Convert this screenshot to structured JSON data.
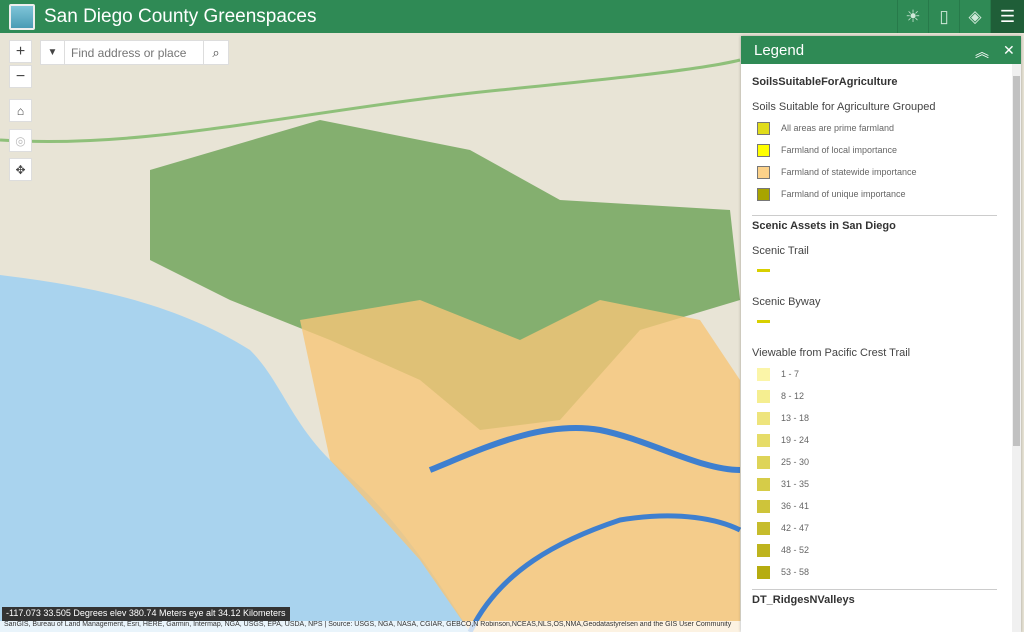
{
  "app": {
    "title": "San Diego County Greenspaces"
  },
  "toolbar": {
    "icons": [
      "sun-icon",
      "basemap-icon",
      "layers-icon",
      "legend-icon"
    ]
  },
  "search": {
    "placeholder": "Find address or place"
  },
  "status": {
    "coords": "-117.073 33.505 Degrees   elev 380.74 Meters   eye alt 34.12 Kilometers",
    "attribution": "SanGIS, Bureau of Land Management, Esri, HERE, Garmin, Intermap, NGA, USGS, EPA, USDA, NPS | Source: USGS, NGA, NASA, CGIAR, GEBCO,N Robinson,NCEAS,NLS,OS,NMA,Geodatastyrelsen and the GIS User Community"
  },
  "legend": {
    "title": "Legend",
    "layer1": {
      "title": "SoilsSuitableForAgriculture",
      "subtitle": "Soils Suitable for Agriculture Grouped",
      "items": [
        {
          "label": "All areas are prime farmland",
          "color": "#e0dc1a"
        },
        {
          "label": "Farmland of local importance",
          "color": "#ffff00"
        },
        {
          "label": "Farmland of statewide importance",
          "color": "#fcd28a"
        },
        {
          "label": "Farmland of unique importance",
          "color": "#a8a400"
        }
      ]
    },
    "layer2": {
      "title": "Scenic Assets in San Diego",
      "trail": "Scenic Trail",
      "byway": "Scenic Byway",
      "viewable": "Viewable from Pacific Crest Trail",
      "ranges": [
        {
          "label": "1 - 7",
          "color": "#fbf5a8"
        },
        {
          "label": "8 - 12",
          "color": "#f5ee90"
        },
        {
          "label": "13 - 18",
          "color": "#eee47c"
        },
        {
          "label": "19 - 24",
          "color": "#e6dc68"
        },
        {
          "label": "25 - 30",
          "color": "#ded458"
        },
        {
          "label": "31 - 35",
          "color": "#d6cc48"
        },
        {
          "label": "36 - 41",
          "color": "#cec43a"
        },
        {
          "label": "42 - 47",
          "color": "#c6bc2c"
        },
        {
          "label": "48 - 52",
          "color": "#beb41e"
        },
        {
          "label": "53 - 58",
          "color": "#b6ac10"
        }
      ]
    },
    "layer3": {
      "title": "DT_RidgesNValleys"
    }
  }
}
